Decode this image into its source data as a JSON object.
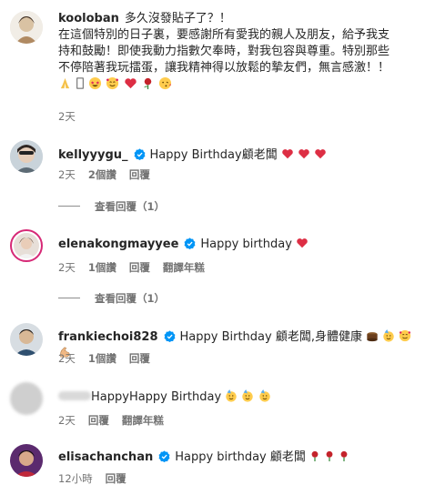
{
  "comments": [
    {
      "username": "kooloban",
      "text_line1": "多久沒發貼子了？！",
      "text_line2": "在這個特別的日子裏，要感謝所有愛我的親人及朋友，給予我支",
      "text_line3": "持和鼓勵！即使我動力指數欠奉時，對我包容與尊重。特別那些",
      "text_line4": "不停陪著我玩擂蛋，讓我精神得以放鬆的摯友們，無言感激！！",
      "time": "2天"
    },
    {
      "username": "kellyyygu_",
      "text": "Happy Birthday顧老闆",
      "time": "2天",
      "likes": "2個讚",
      "reply": "回覆",
      "view_replies": "查看回覆（1）"
    },
    {
      "username": "elenakongmayyee",
      "text": "Happy birthday",
      "time": "2天",
      "likes": "1個讚",
      "reply": "回覆",
      "translate": "翻譯年糕",
      "view_replies": "查看回覆（1）"
    },
    {
      "username": "frankiechoi828",
      "text": "Happy Birthday 顧老闆,身體健康",
      "time": "2天",
      "likes": "1個讚",
      "reply": "回覆"
    },
    {
      "username": "",
      "text": "HappyHappy Birthday",
      "time": "2天",
      "reply": "回覆",
      "translate": "翻譯年糕"
    },
    {
      "username": "elisachanchan",
      "text": "Happy birthday 顧老闆",
      "time": "12小時",
      "reply": "回覆"
    }
  ],
  "colors": {
    "verified": "#0095f6",
    "heart": "#ed4956",
    "ring": "#d62976",
    "muted": "#737373"
  },
  "icons": [
    "verified-badge-icon",
    "red-heart-icon",
    "rose-icon",
    "party-face-icon",
    "smiling-hearts-face-icon",
    "praying-hands-icon",
    "star-struck-face-icon",
    "cake-icon",
    "muscle-icon"
  ]
}
